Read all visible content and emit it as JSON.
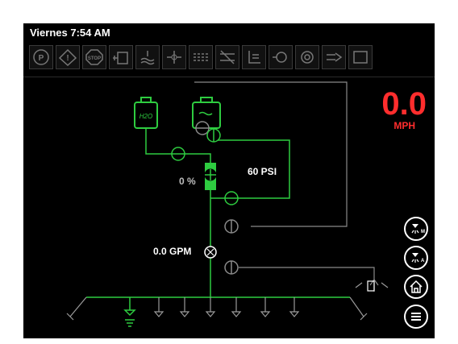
{
  "header": {
    "title": "Viernes 7:54 AM"
  },
  "warnings": [
    {
      "icon": "parking-brake-icon"
    },
    {
      "icon": "warning-icon"
    },
    {
      "icon": "stop-icon"
    },
    {
      "icon": "tank-icon"
    },
    {
      "icon": "water-level-icon"
    },
    {
      "icon": "valve-icon"
    },
    {
      "icon": "valve-multi-icon"
    },
    {
      "icon": "valve-off-icon"
    },
    {
      "icon": "nozzle-icon"
    },
    {
      "icon": "pump-icon"
    },
    {
      "icon": "engine-icon"
    },
    {
      "icon": "hose-icon"
    },
    {
      "icon": "screen-icon"
    }
  ],
  "speed": {
    "value": "0.0",
    "unit": "MPH"
  },
  "diagram": {
    "pump_percent": "0 %",
    "pressure": "60 PSI",
    "flow": "0.0 GPM",
    "tank_left_label": "H2O"
  },
  "colors": {
    "active": "#2ecc40",
    "inactive": "#8a8a8a",
    "speed": "#ff2d2d"
  },
  "side_buttons": [
    {
      "icon": "spray-manual-icon"
    },
    {
      "icon": "spray-auto-icon"
    },
    {
      "icon": "home-icon"
    },
    {
      "icon": "menu-icon"
    }
  ]
}
